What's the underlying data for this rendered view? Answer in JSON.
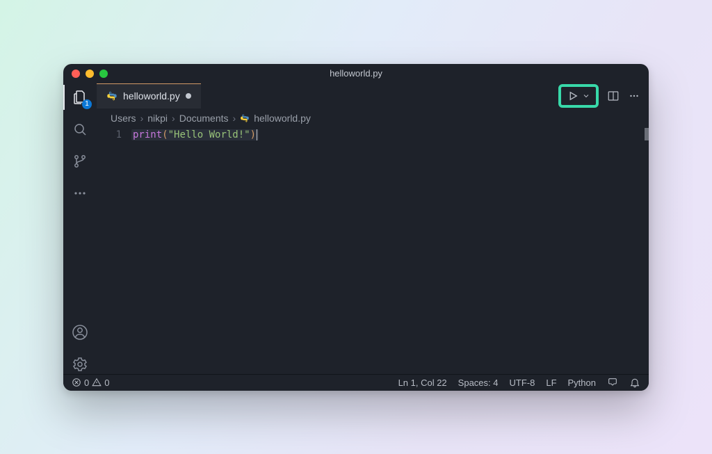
{
  "window": {
    "title": "helloworld.py"
  },
  "activity_badge": "1",
  "tab": {
    "label": "helloworld.py"
  },
  "breadcrumbs": {
    "p0": "Users",
    "p1": "nikpi",
    "p2": "Documents",
    "p3": "helloworld.py"
  },
  "editor": {
    "line_number": "1",
    "tok_func": "print",
    "tok_lparen": "(",
    "tok_str": "\"Hello World!\"",
    "tok_rparen": ")"
  },
  "status": {
    "errors": "0",
    "warnings": "0",
    "cursor": "Ln 1, Col 22",
    "spaces": "Spaces: 4",
    "encoding": "UTF-8",
    "eol": "LF",
    "language": "Python"
  }
}
